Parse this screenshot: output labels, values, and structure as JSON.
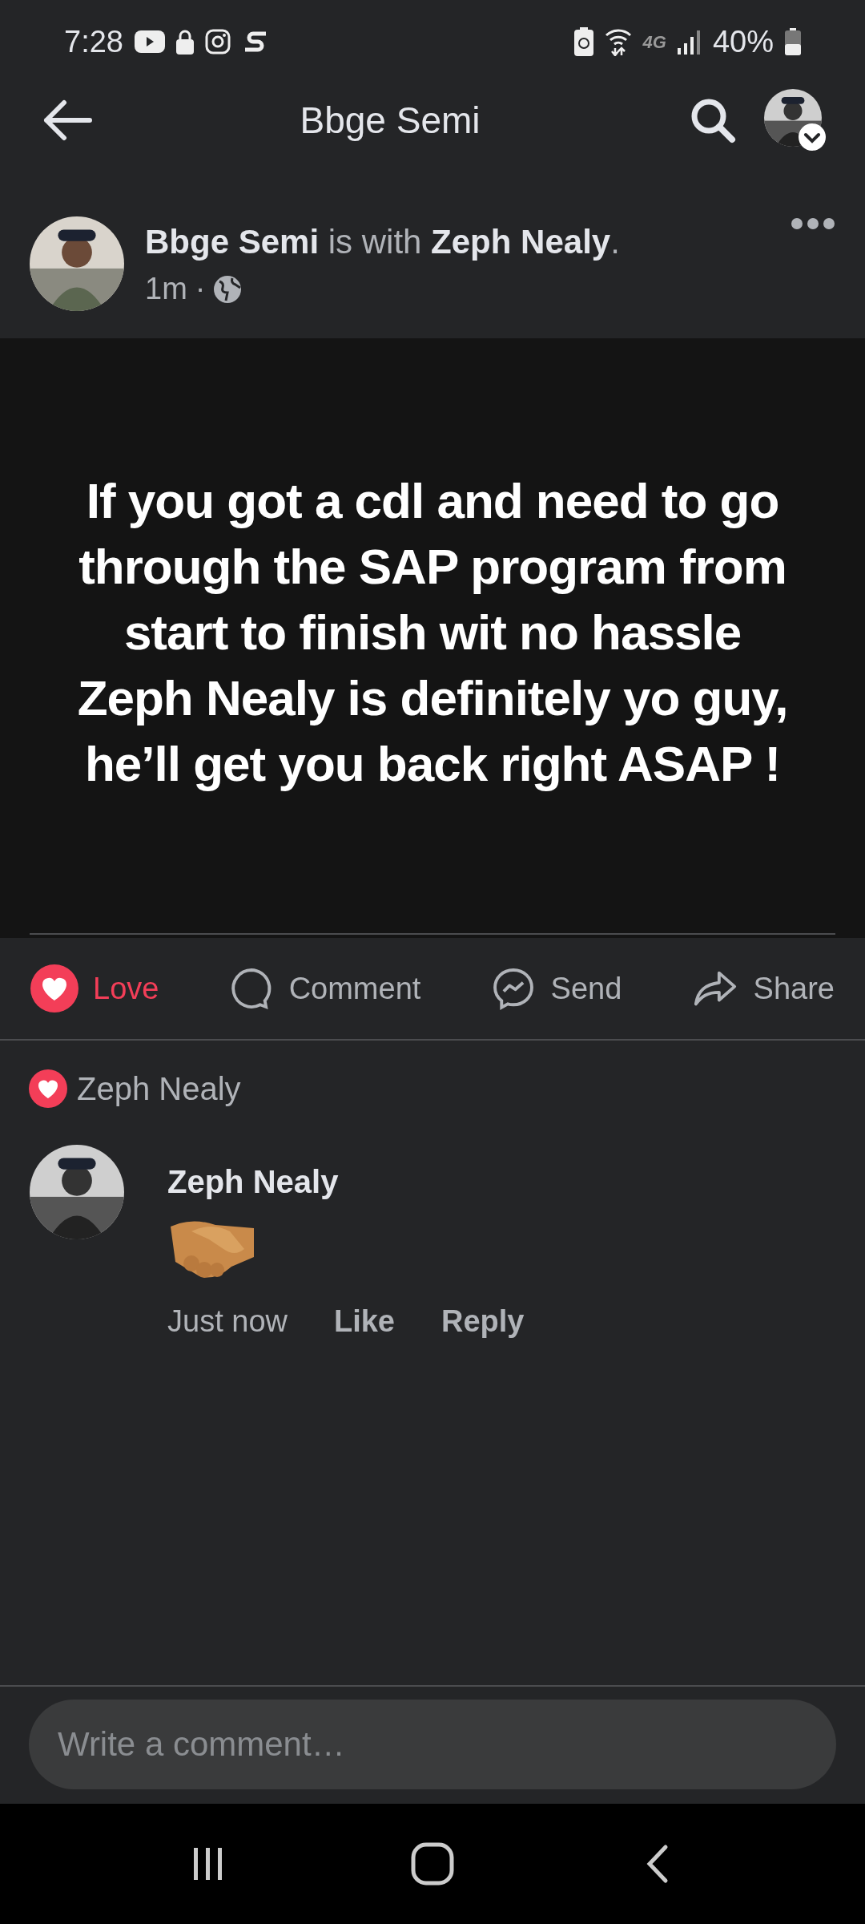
{
  "status_bar": {
    "time": "7:28",
    "network": "4G",
    "battery": "40%"
  },
  "header": {
    "title": "Bbge Semi"
  },
  "post": {
    "author": "Bbge Semi",
    "with_text": "is with",
    "tagged": "Zeph Nealy",
    "end": ".",
    "time": "1m",
    "separator": "·",
    "text": "If you got a cdl and need to go through the SAP program from start to finish wit no hassle Zeph Nealy is definitely yo guy, he’ll get you back right ASAP !"
  },
  "actions": [
    {
      "kind": "love",
      "label": "Love",
      "selected": true
    },
    {
      "kind": "comment",
      "label": "Comment",
      "selected": false
    },
    {
      "kind": "send",
      "label": "Send",
      "selected": false
    },
    {
      "kind": "share",
      "label": "Share",
      "selected": false
    }
  ],
  "reactions": {
    "kind": "love",
    "name": "Zeph Nealy"
  },
  "comments": [
    {
      "author": "Zeph Nealy",
      "kind": "handshake",
      "time": "Just now",
      "like": "Like",
      "reply": "Reply"
    }
  ],
  "composer": {
    "placeholder": "Write a comment…"
  }
}
